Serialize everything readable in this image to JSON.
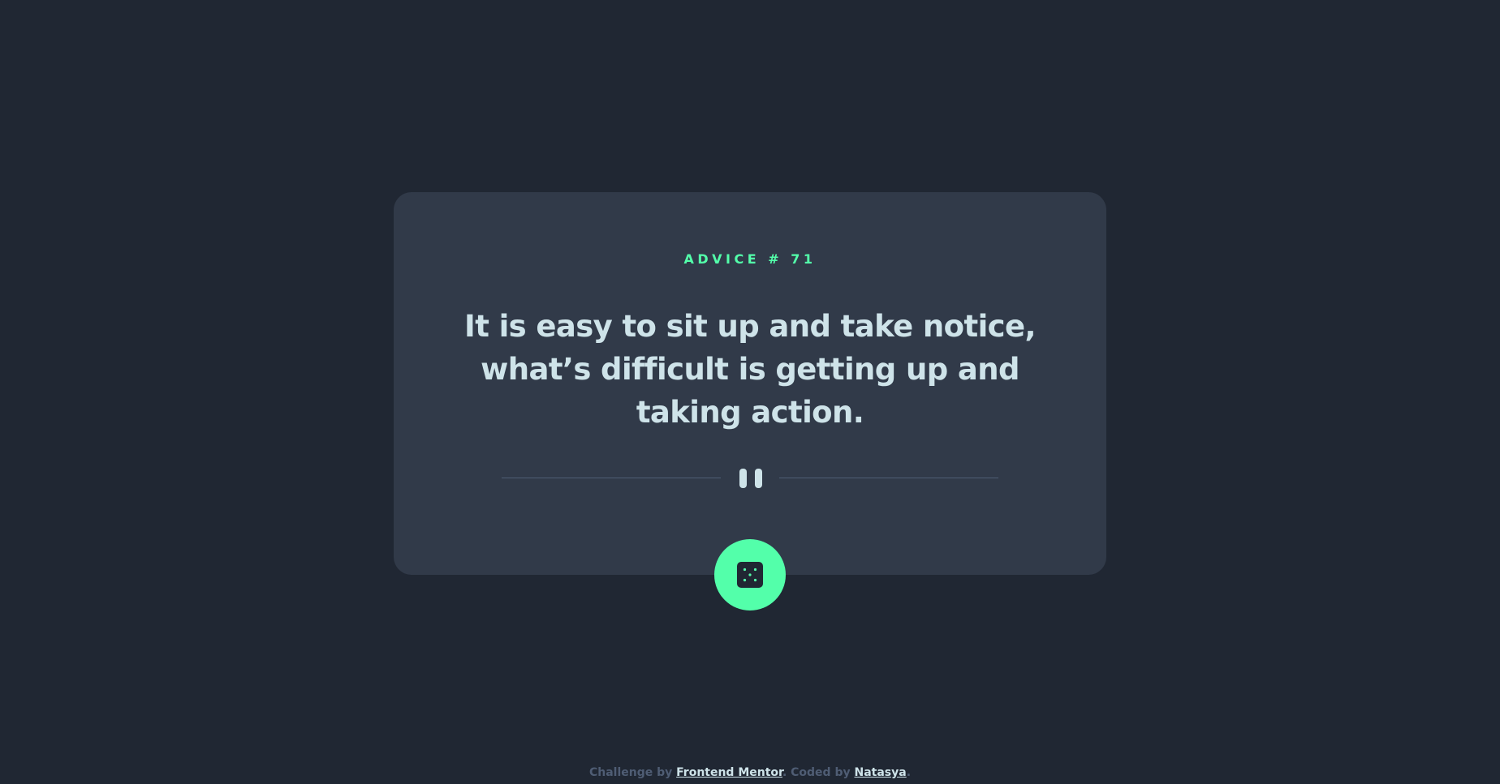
{
  "advice": {
    "label": "ADVICE # 71",
    "quote": "It is easy to sit up and take notice, what’s difficult is getting up and taking action."
  },
  "divider": {
    "icon": "pause-icon"
  },
  "dice_button": {
    "icon": "dice-icon"
  },
  "footer": {
    "prefix": "Challenge by ",
    "challenge_link": "Frontend Mentor",
    "middle": ". Coded by ",
    "author_link": "Natasya",
    "suffix": "."
  },
  "colors": {
    "background": "#202733",
    "card": "#313a49",
    "accent": "#53ffaa",
    "text": "#cee3e9",
    "muted": "#4f5d74"
  }
}
